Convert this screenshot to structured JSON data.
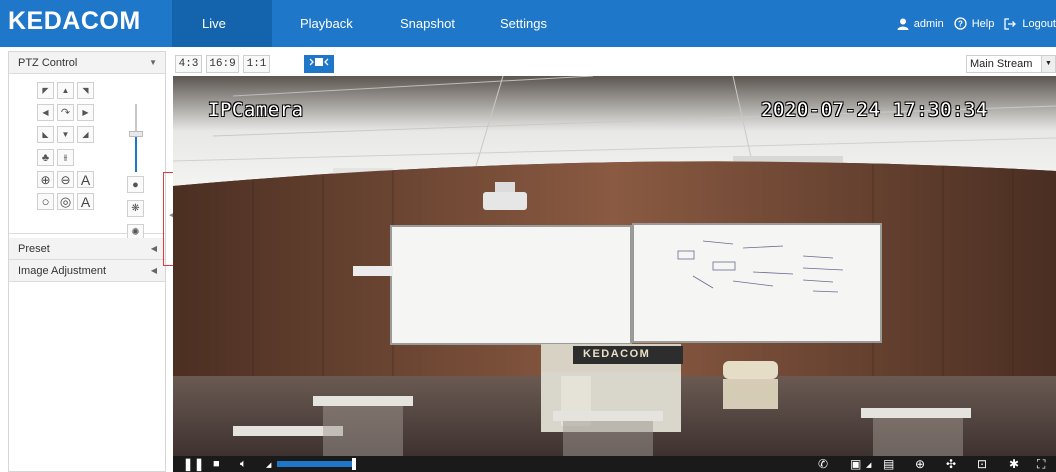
{
  "header": {
    "logo": "KEDACOM",
    "nav": [
      "Live View",
      "Playback",
      "Snapshot",
      "Settings"
    ],
    "active_nav": "Live View",
    "user": "admin",
    "help": "Help",
    "logout": "Logout",
    "bar_color": "#1f77c9"
  },
  "left_panel": {
    "ptz_title": "PTZ Control",
    "preset_title": "Preset",
    "image_adjust_title": "Image Adjustment",
    "text_btn_label": "A",
    "speed_level": 0.5
  },
  "video_toolbar": {
    "ratios": [
      "4:3",
      "16:9",
      "1:1"
    ],
    "stream": "Main Stream"
  },
  "video": {
    "osd_name": "IPCamera",
    "osd_datetime": "2020-07-24 17:30:34",
    "brand_sign": "KEDACOM"
  },
  "controls": {
    "volume_level": 0.95,
    "icons": [
      "pause-icon",
      "stop-icon",
      "volume-icon",
      "talk-icon",
      "snapshot-icon",
      "record-icon",
      "zoom-icon",
      "ptz-3d-icon",
      "image-icon",
      "star-icon",
      "fullscreen-icon"
    ]
  }
}
